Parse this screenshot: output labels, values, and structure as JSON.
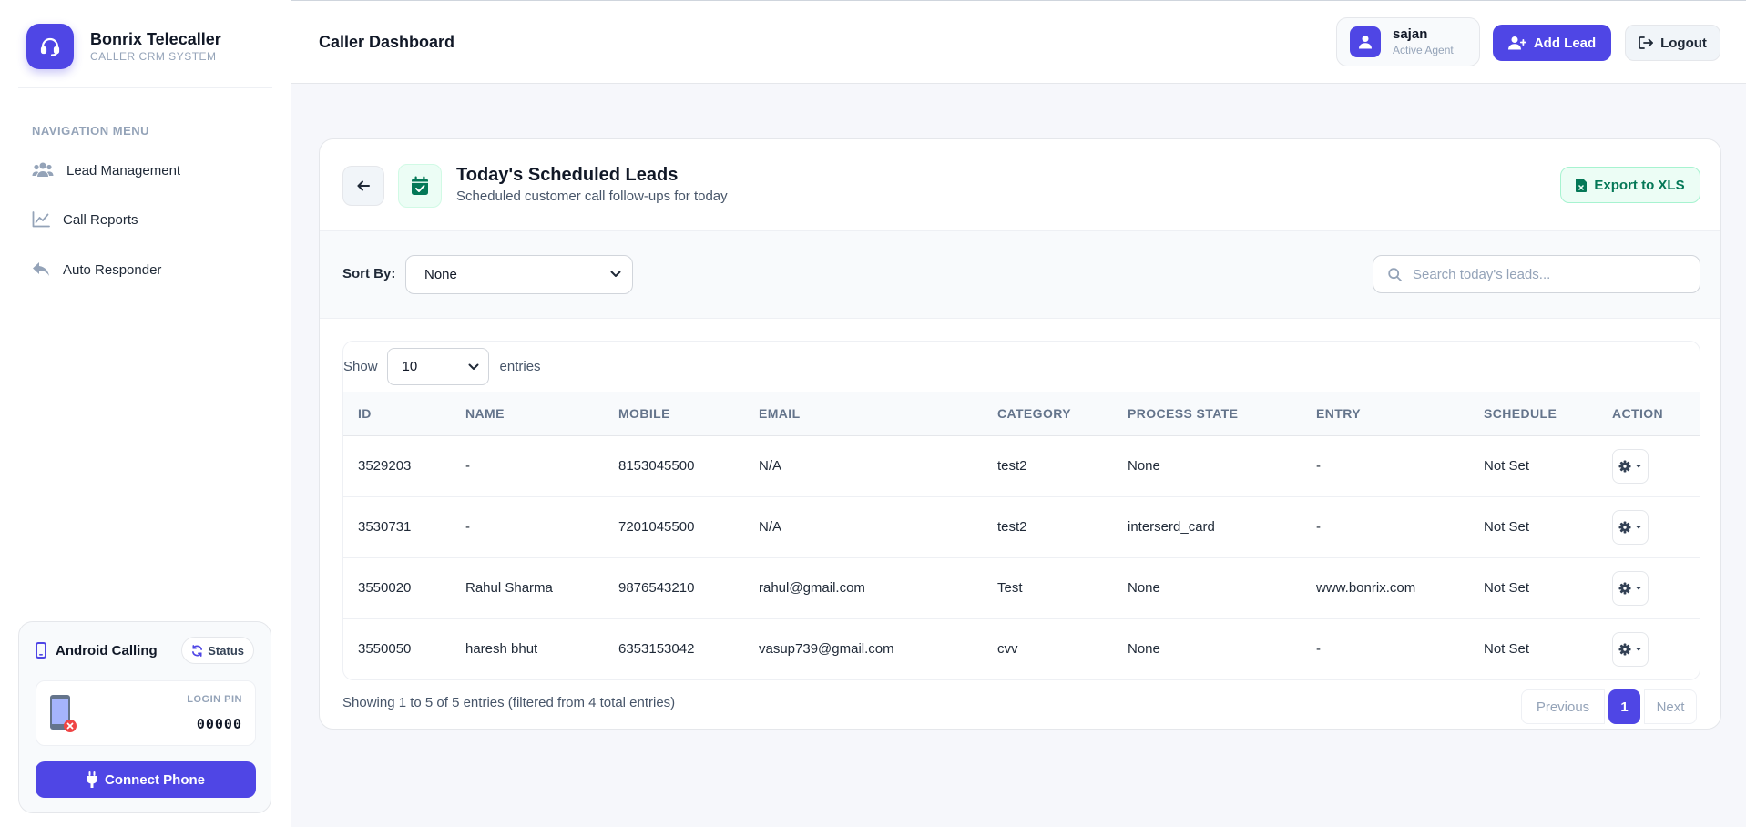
{
  "brand": {
    "name": "Bonrix Telecaller",
    "subtitle": "CALLER CRM SYSTEM"
  },
  "sidebar": {
    "nav_title": "NAVIGATION MENU",
    "items": [
      {
        "label": "Lead Management",
        "icon": "users-icon"
      },
      {
        "label": "Call Reports",
        "icon": "chart-line-icon"
      },
      {
        "label": "Auto Responder",
        "icon": "reply-icon"
      }
    ],
    "android": {
      "title": "Android Calling",
      "status_label": "Status",
      "pin_label": "LOGIN PIN",
      "pin_value": "00000",
      "connect_label": "Connect Phone"
    }
  },
  "header": {
    "title": "Caller Dashboard",
    "user_name": "sajan",
    "user_role": "Active Agent",
    "add_lead_label": "Add Lead",
    "logout_label": "Logout"
  },
  "card": {
    "title": "Today's Scheduled Leads",
    "subtitle": "Scheduled customer call follow-ups for today",
    "export_label": "Export to XLS",
    "sort_label": "Sort By:",
    "sort_value": "None",
    "search_placeholder": "Search today's leads...",
    "show_label": "Show",
    "show_value": "10",
    "entries_label": "entries"
  },
  "table": {
    "columns": [
      "ID",
      "NAME",
      "MOBILE",
      "EMAIL",
      "CATEGORY",
      "PROCESS STATE",
      "ENTRY",
      "SCHEDULE",
      "ACTION"
    ],
    "rows": [
      [
        "3529203",
        "-",
        "8153045500",
        "N/A",
        "test2",
        "None",
        "-",
        "Not Set"
      ],
      [
        "3530731",
        "-",
        "7201045500",
        "N/A",
        "test2",
        "interserd_card",
        "-",
        "Not Set"
      ],
      [
        "3550020",
        "Rahul Sharma",
        "9876543210",
        "rahul@gmail.com",
        "Test",
        "None",
        "www.bonrix.com",
        "Not Set"
      ],
      [
        "3550050",
        "haresh bhut",
        "6353153042",
        "vasup739@gmail.com",
        "cvv",
        "None",
        "-",
        "Not Set"
      ]
    ]
  },
  "footer": {
    "info": "Showing 1 to 5 of 5 entries (filtered from 4 total entries)",
    "prev_label": "Previous",
    "page_label": "1",
    "next_label": "Next"
  },
  "colors": {
    "accent": "#4f46e5",
    "export_green": "#047857",
    "danger": "#ef4444"
  }
}
